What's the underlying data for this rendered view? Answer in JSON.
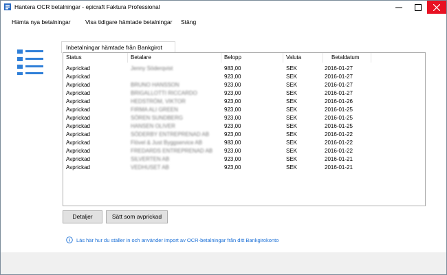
{
  "window": {
    "title": "Hantera OCR betalningar - epicraft Faktura Professional"
  },
  "menu": [
    {
      "label": "Hämta nya betalningar"
    },
    {
      "label": "Visa tidigare hämtade betalningar"
    },
    {
      "label": "Stäng"
    }
  ],
  "tab": {
    "label": "Inbetalningar hämtade från Bankgirot"
  },
  "table": {
    "columns": [
      "Status",
      "Betalare",
      "Belopp",
      "Valuta",
      "Betaldatum"
    ],
    "rows": [
      {
        "status": "Avprickad",
        "payer": "Jenny Söderqvist",
        "amount": "983,00",
        "currency": "SEK",
        "date": "2016-01-27"
      },
      {
        "status": "Avprickad",
        "payer": "",
        "amount": "923,00",
        "currency": "SEK",
        "date": "2016-01-27"
      },
      {
        "status": "Avprickad",
        "payer": "BRUNO HANSSON",
        "amount": "923,00",
        "currency": "SEK",
        "date": "2016-01-27"
      },
      {
        "status": "Avprickad",
        "payer": "BRIGALLOTTI RICCARDO",
        "amount": "923,00",
        "currency": "SEK",
        "date": "2016-01-27"
      },
      {
        "status": "Avprickad",
        "payer": "HEDSTRÖM, VIKTOR",
        "amount": "923,00",
        "currency": "SEK",
        "date": "2016-01-26"
      },
      {
        "status": "Avprickad",
        "payer": "FIRMA ALI GREEN",
        "amount": "923,00",
        "currency": "SEK",
        "date": "2016-01-25"
      },
      {
        "status": "Avprickad",
        "payer": "SÖREN SUNDBERG",
        "amount": "923,00",
        "currency": "SEK",
        "date": "2016-01-25"
      },
      {
        "status": "Avprickad",
        "payer": "HANSEN OLIVER",
        "amount": "923,00",
        "currency": "SEK",
        "date": "2016-01-25"
      },
      {
        "status": "Avprickad",
        "payer": "SÖDERBY ENTREPRENAD AB",
        "amount": "923,00",
        "currency": "SEK",
        "date": "2016-01-22"
      },
      {
        "status": "Avprickad",
        "payer": "Flövel & Just Byggservice AB",
        "amount": "983,00",
        "currency": "SEK",
        "date": "2016-01-22"
      },
      {
        "status": "Avprickad",
        "payer": "FREDARDS ENTREPRENAD AB",
        "amount": "923,00",
        "currency": "SEK",
        "date": "2016-01-22"
      },
      {
        "status": "Avprickad",
        "payer": "SILVERTEN AB",
        "amount": "923,00",
        "currency": "SEK",
        "date": "2016-01-21"
      },
      {
        "status": "Avprickad",
        "payer": "VEDHUSET AB",
        "amount": "923,00",
        "currency": "SEK",
        "date": "2016-01-21"
      }
    ]
  },
  "buttons": {
    "details": "Detaljer",
    "mark_checked": "Sätt som avprickad"
  },
  "info": {
    "text": "Läs här hur du ställer in och använder import av OCR-betalningar från ditt Bankgirokonto"
  },
  "colors": {
    "accent": "#1a6fd6",
    "close_button": "#e81123"
  }
}
